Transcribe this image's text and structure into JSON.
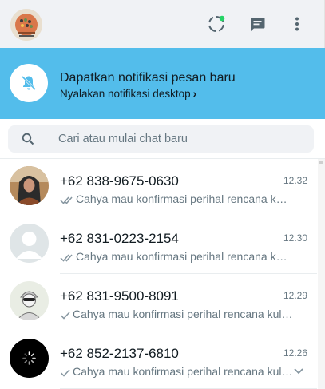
{
  "header": {
    "icons": [
      "avatar",
      "status-icon",
      "new-chat-icon",
      "menu-icon"
    ]
  },
  "notification": {
    "title": "Dapatkan notifikasi pesan baru",
    "link": "Nyalakan notifikasi desktop",
    "icon": "bell-off-icon",
    "bg_color": "#53bdeb"
  },
  "search": {
    "placeholder": "Cari atau mulai chat baru"
  },
  "chats": [
    {
      "name": "+62 838-9675-0630",
      "time": "12.32",
      "preview": "Cahya mau konfirmasi perihal rencana kuliah ...",
      "ticks": "double"
    },
    {
      "name": "+62 831-0223-2154",
      "time": "12.30",
      "preview": "Cahya mau konfirmasi perihal rencana kuliah...",
      "ticks": "double"
    },
    {
      "name": "+62 831-9500-8091",
      "time": "12.29",
      "preview": "Cahya mau konfirmasi perihal rencana kuliah ...",
      "ticks": "single"
    },
    {
      "name": "+62 852-2137-6810",
      "time": "12.26",
      "preview": "Cahya mau konfirmasi perihal rencana kuliah ...",
      "ticks": "single"
    }
  ]
}
